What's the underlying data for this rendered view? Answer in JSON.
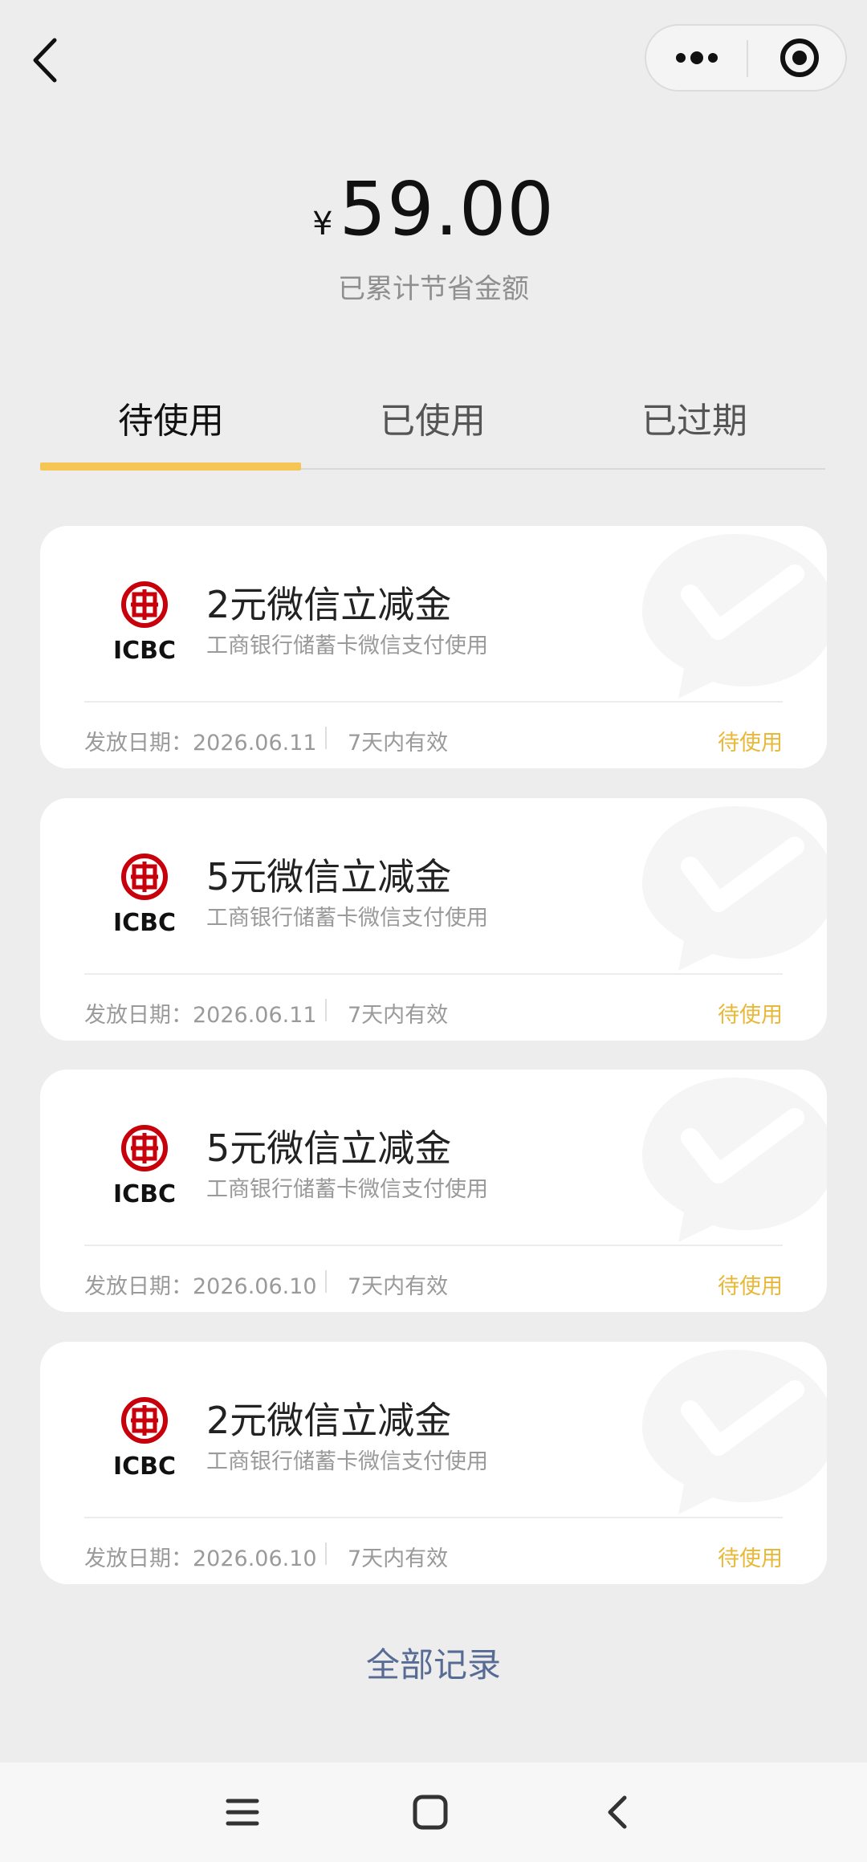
{
  "topbar": {
    "back_icon": "chevron-left-icon",
    "more_icon": "more-dots-icon",
    "close_icon": "target-circle-icon"
  },
  "summary": {
    "currency": "¥",
    "amount": "59.00",
    "caption": "已累计节省金额"
  },
  "tabs": [
    {
      "label": "待使用",
      "active": true
    },
    {
      "label": "已使用",
      "active": false
    },
    {
      "label": "已过期",
      "active": false
    }
  ],
  "colors": {
    "accent_yellow": "#f6c654",
    "status_yellow": "#e8b83a",
    "link_blue": "#576b95",
    "icbc_red": "#c7000b"
  },
  "coupons": [
    {
      "bank_logo_text": "ICBC",
      "title": "2元微信立减金",
      "subtitle": "工商银行储蓄卡微信支付使用",
      "issue_date": "发放日期：2026.06.11",
      "validity": "7天内有效",
      "status": "待使用"
    },
    {
      "bank_logo_text": "ICBC",
      "title": "5元微信立减金",
      "subtitle": "工商银行储蓄卡微信支付使用",
      "issue_date": "发放日期：2026.06.11",
      "validity": "7天内有效",
      "status": "待使用"
    },
    {
      "bank_logo_text": "ICBC",
      "title": "5元微信立减金",
      "subtitle": "工商银行储蓄卡微信支付使用",
      "issue_date": "发放日期：2026.06.10",
      "validity": "7天内有效",
      "status": "待使用"
    },
    {
      "bank_logo_text": "ICBC",
      "title": "2元微信立减金",
      "subtitle": "工商银行储蓄卡微信支付使用",
      "issue_date": "发放日期：2026.06.10",
      "validity": "7天内有效",
      "status": "待使用"
    }
  ],
  "footer": {
    "all_records": "全部记录"
  },
  "system_nav": {
    "menu_icon": "menu-lines-icon",
    "home_icon": "home-square-icon",
    "back_icon": "back-arrow-icon"
  }
}
